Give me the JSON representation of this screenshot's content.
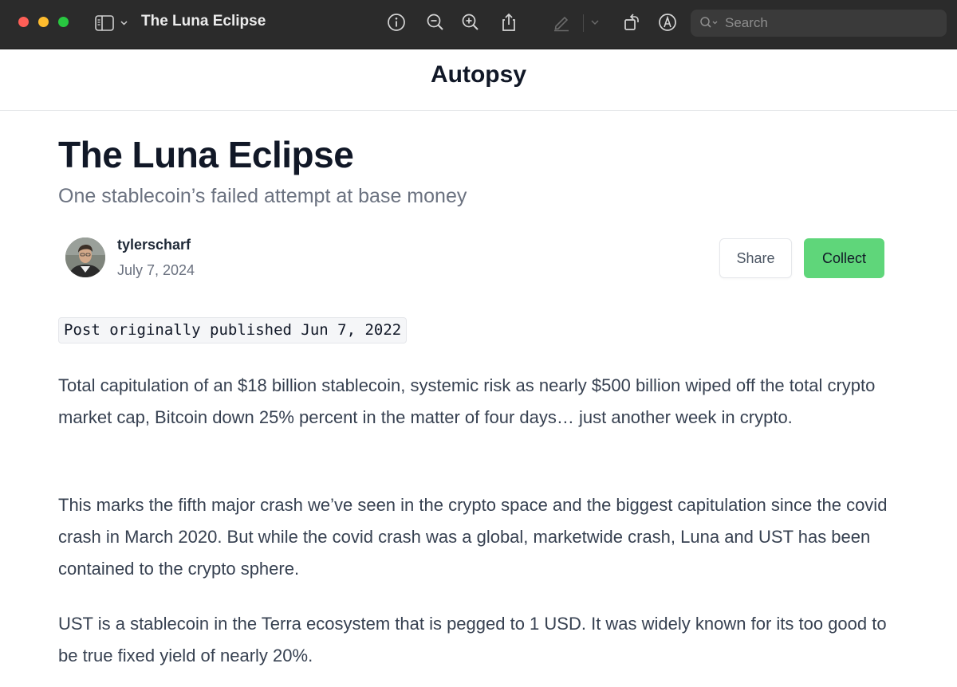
{
  "window": {
    "title": "The Luna Eclipse",
    "search_placeholder": "Search"
  },
  "site": {
    "name": "Autopsy"
  },
  "post": {
    "title": "The Luna Eclipse",
    "subtitle": "One stablecoin’s failed attempt at base money",
    "author": "tylerscharf",
    "date": "July 7, 2024",
    "share_label": "Share",
    "collect_label": "Collect",
    "original_published": "Post originally published Jun 7, 2022",
    "paragraphs": [
      "Total capitulation of an $18 billion stablecoin, systemic risk as nearly $500 billion wiped off the total crypto market cap, Bitcoin down 25% percent in the matter of four days… just another week in crypto.",
      "This marks the fifth major crash we’ve seen in the crypto space and the biggest capitulation since the covid crash in March 2020. But while the covid crash was a global, marketwide crash, Luna and UST has been contained to the crypto sphere.",
      "UST is a stablecoin in the Terra ecosystem that is pegged to 1 USD. It was widely known for its too good to be true fixed yield of nearly 20%."
    ]
  },
  "colors": {
    "toolbar_bg": "#2b2b2b",
    "collect_button": "#5fd67a",
    "title_text": "#111827",
    "subtitle_text": "#6b7280",
    "body_text": "#374151"
  }
}
